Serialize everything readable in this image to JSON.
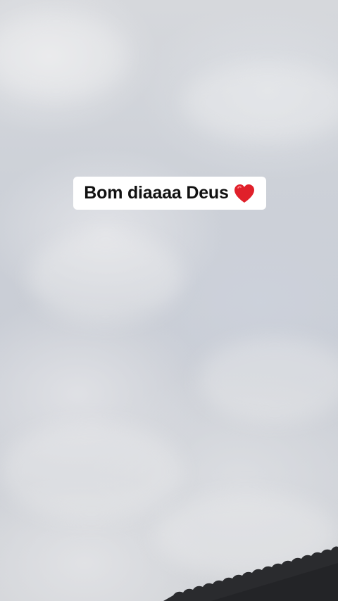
{
  "caption": {
    "text": "Bom diaaaa Deus",
    "emoji": "heart-icon",
    "emoji_color": "#e0202a"
  },
  "scene": {
    "background": "cloudy-sky",
    "foreground": "roof-edge"
  }
}
